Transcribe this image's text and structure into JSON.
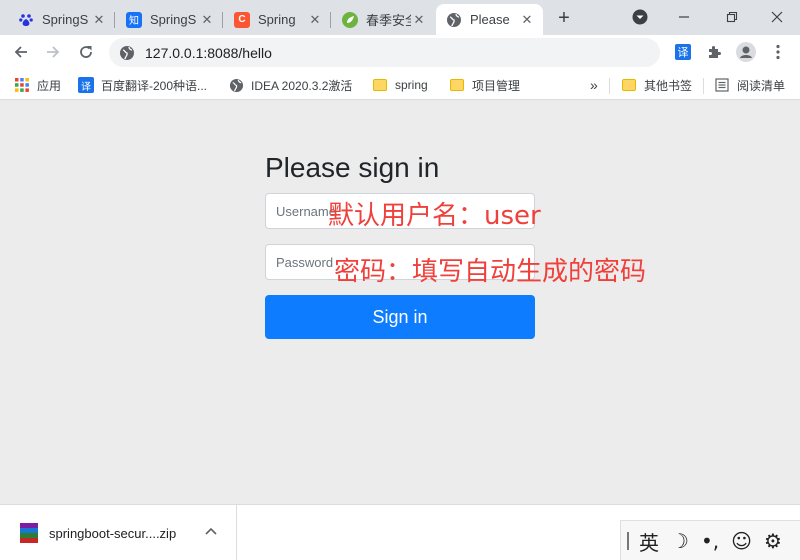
{
  "tabs": [
    {
      "title": "SpringS",
      "icon": "baidu-paw-icon",
      "color": "#2932e1"
    },
    {
      "title": "SpringS",
      "icon": "zhihu-icon",
      "color": "#1772f6"
    },
    {
      "title": "Spring",
      "icon": "csdn-icon",
      "color": "#fc5531"
    },
    {
      "title": "春季安全",
      "icon": "spring-leaf-icon",
      "color": "#6db33f"
    },
    {
      "title": "Please",
      "icon": "globe-icon",
      "color": "#5f6368",
      "active": true
    }
  ],
  "toolbar": {
    "url": "127.0.0.1:8088/hello",
    "translate_icon": "译"
  },
  "bookmarks": {
    "apps": "应用",
    "translate": "百度翻译-200种语...",
    "idea": "IDEA 2020.3.2激活",
    "spring": "spring",
    "project": "项目管理",
    "overflow": "»",
    "other": "其他书签",
    "reading": "阅读清单"
  },
  "page": {
    "heading": "Please sign in",
    "username_placeholder": "Username",
    "password_placeholder": "Password",
    "signin_label": "Sign in"
  },
  "annotations": {
    "username_note": "默认用户名：user",
    "password_note": "密码：填写自动生成的密码",
    "color": "#f0403c"
  },
  "downloads": {
    "filename": "springboot-secur....zip"
  },
  "ime": {
    "lang": "英",
    "moon": "☽",
    "punct": "•,",
    "emoji": "☺",
    "settings": "⚙"
  }
}
